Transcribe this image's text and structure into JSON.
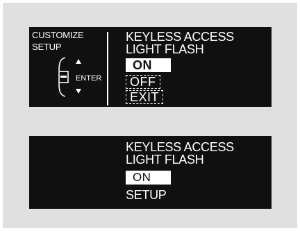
{
  "top_screen": {
    "header_line1": "CUSTOMIZE",
    "header_line2": "SETUP",
    "enter_label": "ENTER",
    "title_line1": "KEYLESS ACCESS",
    "title_line2": "LIGHT FLASH",
    "options": [
      "ON",
      "OFF",
      "EXIT"
    ],
    "selected_option": "ON",
    "icons": [
      "up-arrow-icon",
      "down-arrow-icon",
      "selector-knob-icon"
    ]
  },
  "bottom_screen": {
    "title_line1": "KEYLESS ACCESS",
    "title_line2": "LIGHT FLASH",
    "selected_value": "ON",
    "footer": "SETUP"
  },
  "colors": {
    "screen_bg": "#101010",
    "frame_bg": "#e0e0e0",
    "text": "#ffffff"
  }
}
